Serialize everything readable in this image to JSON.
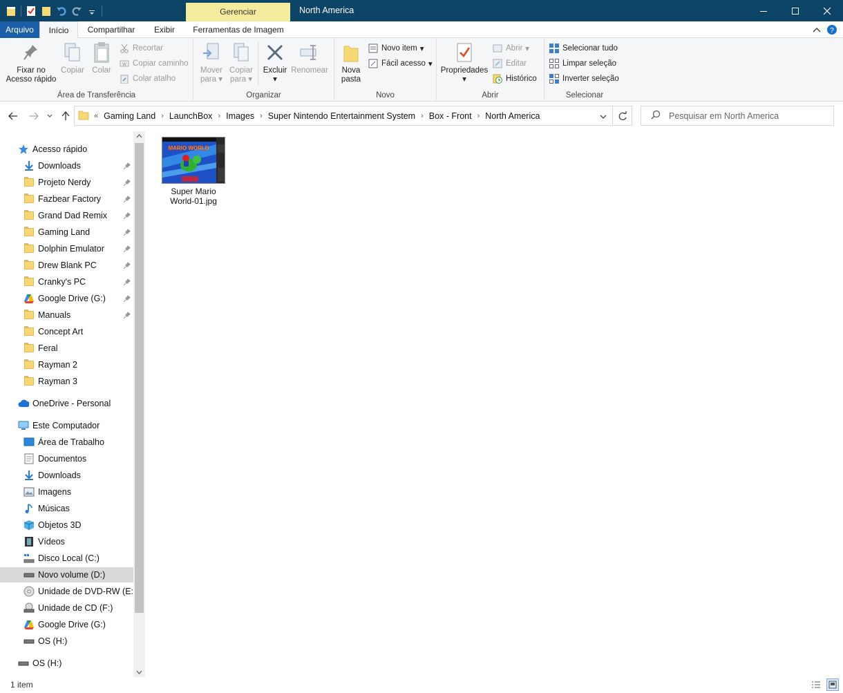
{
  "titlebar": {
    "context_tab": "Gerenciar",
    "title": "North America"
  },
  "tabs": {
    "arquivo": "Arquivo",
    "inicio": "Início",
    "compartilhar": "Compartilhar",
    "exibir": "Exibir",
    "ferramentas": "Ferramentas de Imagem"
  },
  "ribbon": {
    "clipboard": {
      "label": "Área de Transferência",
      "pin_line1": "Fixar no",
      "pin_line2": "Acesso rápido",
      "copy": "Copiar",
      "paste": "Colar",
      "cut": "Recortar",
      "copy_path": "Copiar caminho",
      "paste_shortcut": "Colar atalho"
    },
    "organize": {
      "label": "Organizar",
      "move_line1": "Mover",
      "move_line2": "para",
      "copy_line1": "Copiar",
      "copy_line2": "para",
      "delete": "Excluir",
      "rename": "Renomear"
    },
    "new": {
      "label": "Novo",
      "folder_line1": "Nova",
      "folder_line2": "pasta",
      "new_item": "Novo item",
      "easy_access": "Fácil acesso"
    },
    "open": {
      "label": "Abrir",
      "properties": "Propriedades",
      "open": "Abrir",
      "edit": "Editar",
      "history": "Histórico"
    },
    "select": {
      "label": "Selecionar",
      "select_all": "Selecionar tudo",
      "select_none": "Limpar seleção",
      "invert": "Inverter seleção"
    }
  },
  "address": {
    "overflow": "«",
    "crumbs": [
      "Gaming Land",
      "LaunchBox",
      "Images",
      "Super Nintendo Entertainment System",
      "Box - Front",
      "North America"
    ]
  },
  "search": {
    "placeholder": "Pesquisar em North America"
  },
  "nav": {
    "quick_access": "Acesso rápido",
    "quick_items": [
      "Downloads",
      "Projeto Nerdy",
      "Fazbear Factory",
      "Grand Dad Remix",
      "Gaming Land",
      "Dolphin Emulator",
      "Drew Blank PC",
      "Cranky's PC",
      "Google Drive (G:)",
      "Manuals",
      "Concept Art",
      "Feral",
      "Rayman 2",
      "Rayman 3"
    ],
    "onedrive": "OneDrive - Personal",
    "this_pc": "Este Computador",
    "pc_items": [
      "Área de Trabalho",
      "Documentos",
      "Downloads",
      "Imagens",
      "Músicas",
      "Objetos 3D",
      "Vídeos",
      "Disco Local (C:)",
      "Novo volume (D:)",
      "Unidade de DVD-RW (E:) S",
      "Unidade de CD (F:)",
      "Google Drive (G:)",
      "OS (H:)"
    ],
    "last": "OS (H:)"
  },
  "file": {
    "name_line1": "Super Mario",
    "name_line2": "World-01.jpg",
    "thumb_logo": "MARIO WORLD"
  },
  "status": {
    "count": "1 item"
  },
  "colors": {
    "titlebar": "#0c4468",
    "context_tab": "#f4ec9c",
    "file_tab": "#1a5fa8",
    "selection": "#d9d9d9"
  }
}
